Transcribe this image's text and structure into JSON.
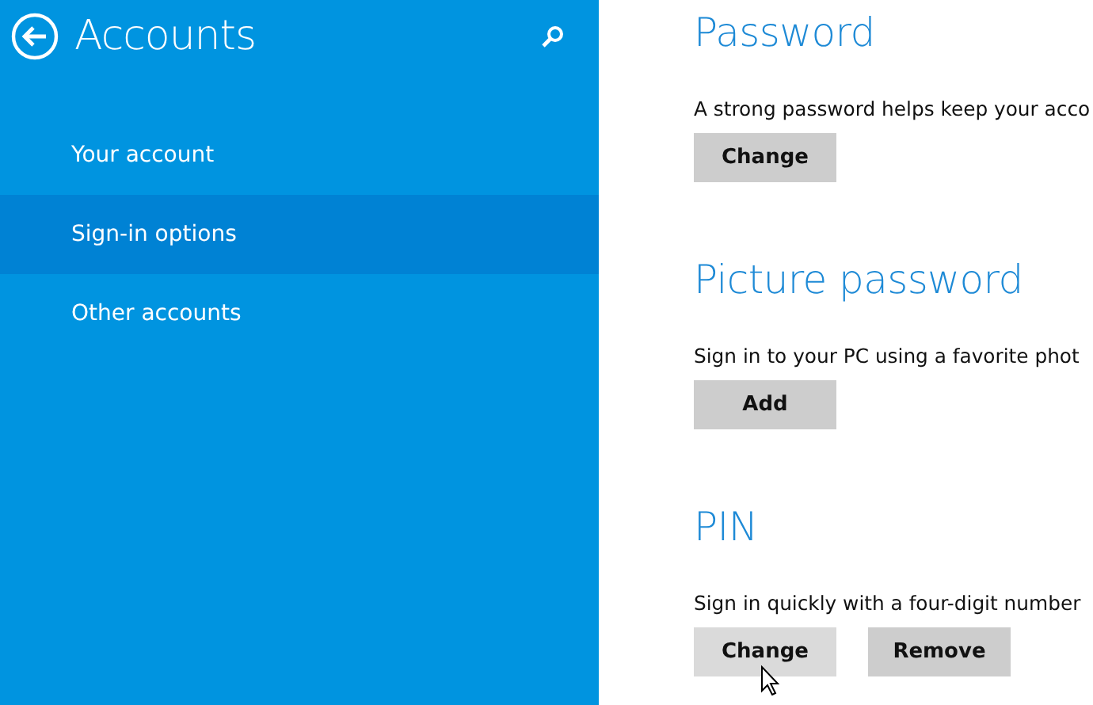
{
  "sidebar": {
    "title": "Accounts",
    "items": [
      {
        "label": "Your account",
        "selected": false
      },
      {
        "label": "Sign-in options",
        "selected": true
      },
      {
        "label": "Other accounts",
        "selected": false
      }
    ]
  },
  "sections": [
    {
      "heading": "Password",
      "description": "A strong password helps keep your acco",
      "buttons": [
        {
          "label": "Change",
          "hovered": false
        }
      ]
    },
    {
      "heading": "Picture password",
      "description": "Sign in to your PC using a favorite phot",
      "buttons": [
        {
          "label": "Add",
          "hovered": false
        }
      ]
    },
    {
      "heading": "PIN",
      "description": "Sign in quickly with a four-digit number",
      "buttons": [
        {
          "label": "Change",
          "hovered": true
        },
        {
          "label": "Remove",
          "hovered": false
        }
      ]
    }
  ]
}
